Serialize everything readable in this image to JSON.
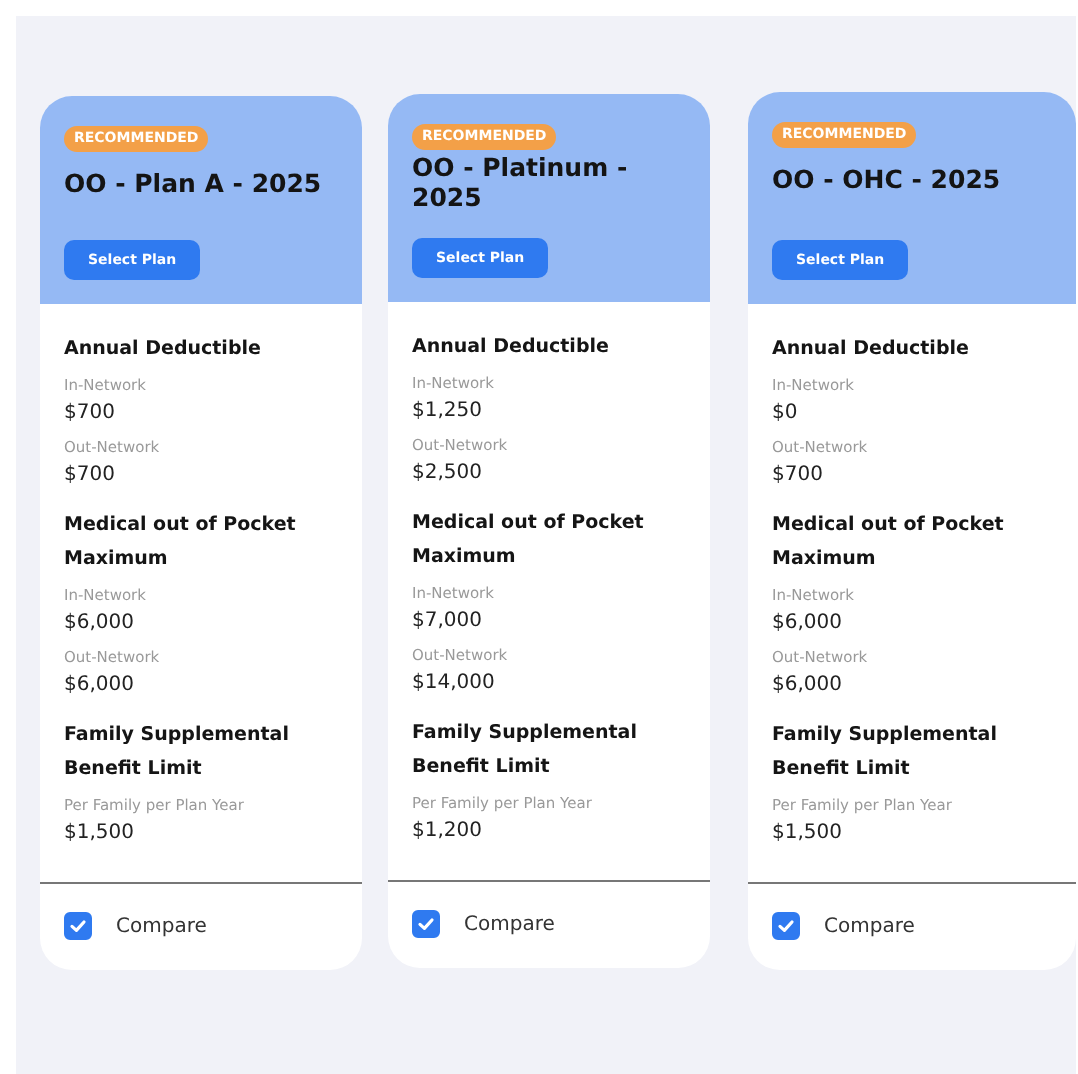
{
  "plans": [
    {
      "badge": "RECOMMENDED",
      "title": "OO - Plan A - 2025",
      "button": "Select Plan",
      "sections": [
        {
          "title": "Annual Deductible",
          "rows": [
            {
              "label": "In-Network",
              "value": "$700"
            },
            {
              "label": "Out-Network",
              "value": "$700"
            }
          ]
        },
        {
          "title": "Medical out of Pocket Maximum",
          "rows": [
            {
              "label": "In-Network",
              "value": "$6,000"
            },
            {
              "label": "Out-Network",
              "value": "$6,000"
            }
          ]
        },
        {
          "title": "Family Supplemental Benefit Limit",
          "rows": [
            {
              "label": "Per Family per Plan Year",
              "value": "$1,500"
            }
          ]
        }
      ],
      "compare": {
        "label": "Compare",
        "checked": true
      }
    },
    {
      "badge": "RECOMMENDED",
      "title": "OO - Platinum - 2025",
      "button": "Select Plan",
      "sections": [
        {
          "title": "Annual Deductible",
          "rows": [
            {
              "label": "In-Network",
              "value": "$1,250"
            },
            {
              "label": "Out-Network",
              "value": "$2,500"
            }
          ]
        },
        {
          "title": "Medical out of Pocket Maximum",
          "rows": [
            {
              "label": "In-Network",
              "value": "$7,000"
            },
            {
              "label": "Out-Network",
              "value": "$14,000"
            }
          ]
        },
        {
          "title": "Family Supplemental Benefit Limit",
          "rows": [
            {
              "label": "Per Family per Plan Year",
              "value": "$1,200"
            }
          ]
        }
      ],
      "compare": {
        "label": "Compare",
        "checked": true
      }
    },
    {
      "badge": "RECOMMENDED",
      "title": "OO - OHC - 2025",
      "button": "Select Plan",
      "sections": [
        {
          "title": "Annual Deductible",
          "rows": [
            {
              "label": "In-Network",
              "value": "$0"
            },
            {
              "label": "Out-Network",
              "value": "$700"
            }
          ]
        },
        {
          "title": "Medical out of Pocket Maximum",
          "rows": [
            {
              "label": "In-Network",
              "value": "$6,000"
            },
            {
              "label": "Out-Network",
              "value": "$6,000"
            }
          ]
        },
        {
          "title": "Family Supplemental Benefit Limit",
          "rows": [
            {
              "label": "Per Family per Plan Year",
              "value": "$1,500"
            }
          ]
        }
      ],
      "compare": {
        "label": "Compare",
        "checked": true
      }
    }
  ]
}
